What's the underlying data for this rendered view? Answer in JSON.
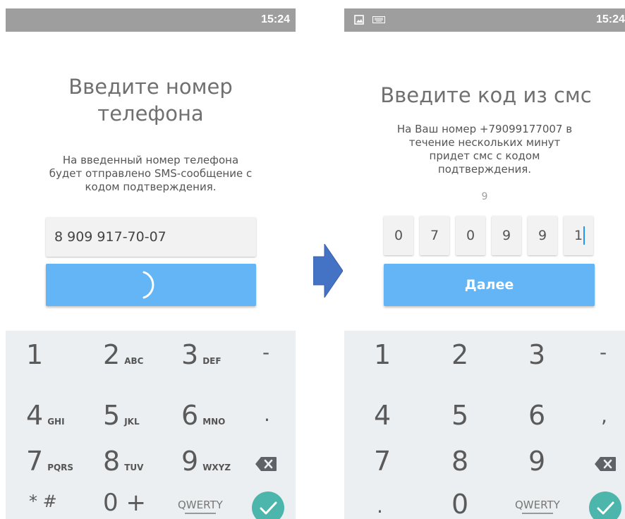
{
  "left": {
    "clock": "15:24",
    "title_line1": "Введите номер",
    "title_line2": "телефона",
    "subtitle_line1": "На введенный номер телефона",
    "subtitle_line2": "будет отправлено SMS-сообщение с",
    "subtitle_line3": "кодом подтверждения.",
    "phone_value": "8 909 917-70-07",
    "keys": [
      {
        "num": "1",
        "letters": ""
      },
      {
        "num": "2",
        "letters": "ABC"
      },
      {
        "num": "3",
        "letters": "DEF"
      },
      {
        "num": "-",
        "letters": ""
      },
      {
        "num": "4",
        "letters": "GHI"
      },
      {
        "num": "5",
        "letters": "JKL"
      },
      {
        "num": "6",
        "letters": "MNO"
      },
      {
        "num": ".",
        "letters": ""
      },
      {
        "num": "7",
        "letters": "PQRS"
      },
      {
        "num": "8",
        "letters": "TUV"
      },
      {
        "num": "9",
        "letters": "WXYZ"
      },
      {
        "num": "* #",
        "letters": ""
      },
      {
        "num": "0 +",
        "letters": ""
      }
    ],
    "qwerty": "QWERTY"
  },
  "right": {
    "clock": "15:24",
    "title": "Введите код из смс",
    "subtitle_line1": "На Ваш номер +79099177007 в",
    "subtitle_line2": "течение нескольких минут",
    "subtitle_line3": "придет смс с кодом",
    "subtitle_line4": "подтверждения.",
    "hint": "9",
    "code_digits": [
      "0",
      "7",
      "0",
      "9",
      "9",
      "1"
    ],
    "next_label": "Далее",
    "keys": [
      "1",
      "2",
      "3",
      "-",
      "4",
      "5",
      "6",
      ",",
      "7",
      "8",
      "9",
      ".",
      "0"
    ],
    "qwerty": "QWERTY"
  },
  "colors": {
    "accent": "#64b5f6",
    "statusbar": "#9e9e9e",
    "enter": "#4db6ac",
    "arrow": "#4472c4"
  }
}
